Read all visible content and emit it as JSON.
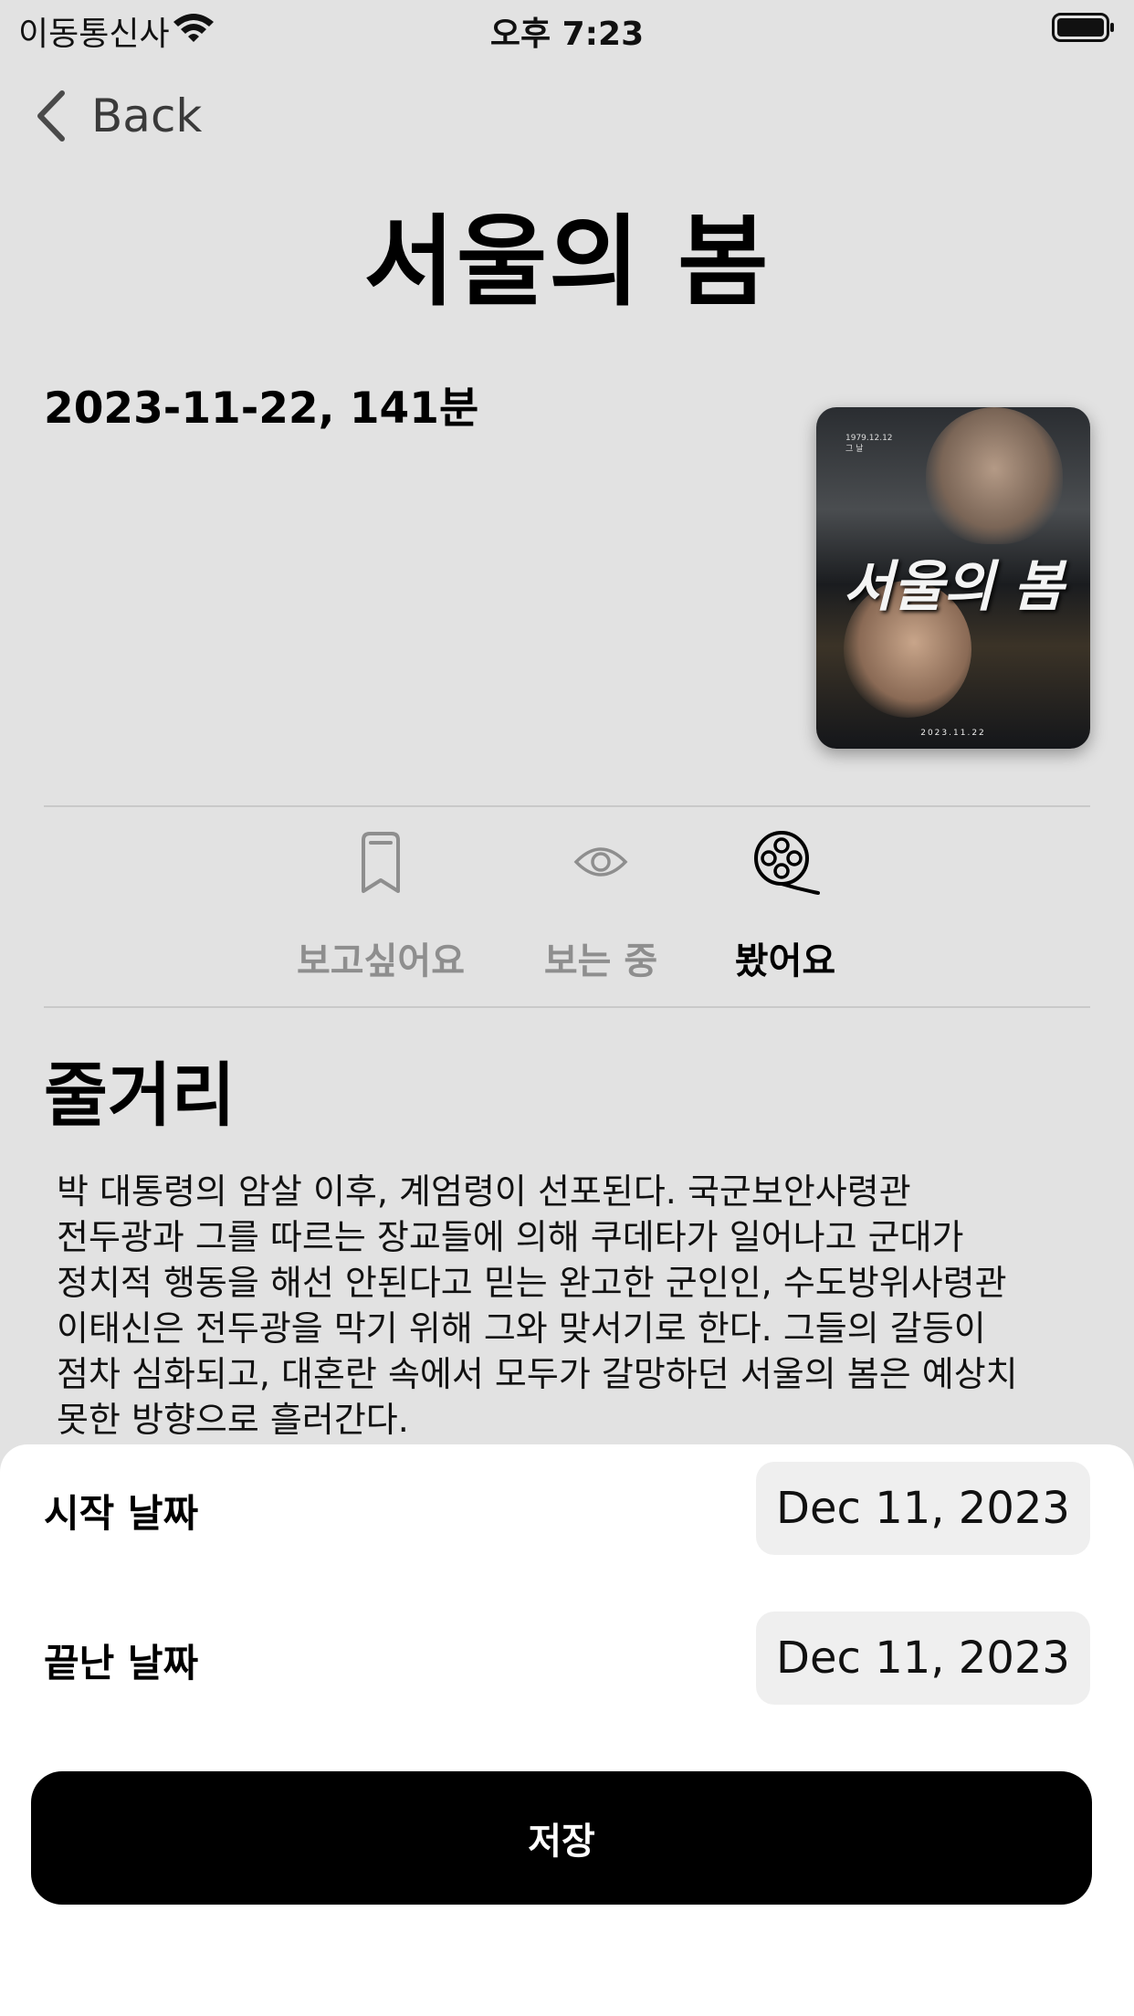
{
  "status_bar": {
    "carrier": "이동통신사",
    "time": "오후 7:23"
  },
  "nav": {
    "back_label": "Back"
  },
  "movie": {
    "title": "서울의 봄",
    "meta": "2023-11-22, 141분",
    "poster": {
      "title": "서울의 봄",
      "caption_line1": "1979.12.12",
      "caption_line2": "그 날",
      "date": "2023.11.22"
    }
  },
  "watch_status": {
    "tabs": [
      {
        "label": "보고싶어요",
        "icon": "bookmark-icon",
        "selected": false
      },
      {
        "label": "보는 중",
        "icon": "eye-icon",
        "selected": false
      },
      {
        "label": "봤어요",
        "icon": "film-reel-icon",
        "selected": true
      }
    ]
  },
  "synopsis": {
    "heading": "줄거리",
    "text": "박 대통령의 암살 이후, 계엄령이 선포된다. 국군보안사령관\n전두광과 그를 따르는 장교들에 의해 쿠데타가 일어나고 군대가\n정치적 행동을 해선 안된다고 믿는 완고한 군인인, 수도방위사령관\n이태신은 전두광을 막기 위해 그와 맞서기로 한다. 그들의 갈등이\n점차 심화되고, 대혼란 속에서 모두가 갈망하던 서울의 봄은 예상치\n못한 방향으로 흘러간다."
  },
  "sheet": {
    "start_label": "시작 날짜",
    "start_value": "Dec 11, 2023",
    "end_label": "끝난 날짜",
    "end_value": "Dec 11, 2023",
    "save_label": "저장"
  },
  "colors": {
    "selected": "#000000",
    "unselected": "#8e8e8e",
    "background": "#e2e2e2"
  }
}
